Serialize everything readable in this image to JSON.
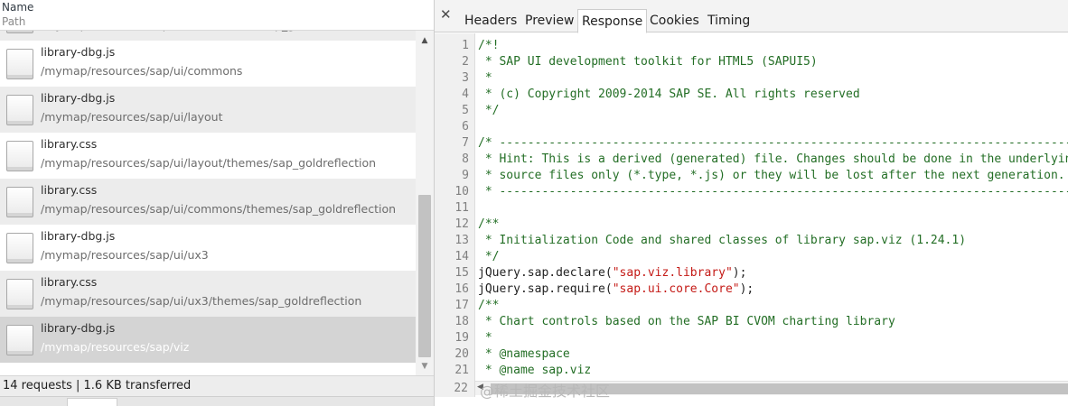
{
  "network": {
    "header": {
      "name": "Name",
      "path": "Path"
    },
    "requests": [
      {
        "name": "",
        "path": "/mymap/resources/sap/ui/core/themes/sap_goldreflection",
        "selected": false,
        "partial": true
      },
      {
        "name": "library-dbg.js",
        "path": "/mymap/resources/sap/ui/commons",
        "selected": false
      },
      {
        "name": "library-dbg.js",
        "path": "/mymap/resources/sap/ui/layout",
        "selected": false
      },
      {
        "name": "library.css",
        "path": "/mymap/resources/sap/ui/layout/themes/sap_goldreflection",
        "selected": false
      },
      {
        "name": "library.css",
        "path": "/mymap/resources/sap/ui/commons/themes/sap_goldreflection",
        "selected": false
      },
      {
        "name": "library-dbg.js",
        "path": "/mymap/resources/sap/ui/ux3",
        "selected": false
      },
      {
        "name": "library.css",
        "path": "/mymap/resources/sap/ui/ux3/themes/sap_goldreflection",
        "selected": false
      },
      {
        "name": "library-dbg.js",
        "path": "/mymap/resources/sap/viz",
        "selected": true
      }
    ],
    "status": "14 requests | 1.6 KB transferred",
    "scroll_up_icon": "▲",
    "scroll_down_icon": "▼"
  },
  "detail": {
    "close_icon": "✕",
    "tabs": [
      {
        "label": "Headers",
        "active": false
      },
      {
        "label": "Preview",
        "active": false
      },
      {
        "label": "Response",
        "active": true
      },
      {
        "label": "Cookies",
        "active": false
      },
      {
        "label": "Timing",
        "active": false
      }
    ],
    "code_lines": [
      {
        "n": "1",
        "parts": [
          {
            "t": "/*!",
            "c": "comment"
          }
        ]
      },
      {
        "n": "2",
        "parts": [
          {
            "t": " * SAP UI development toolkit for HTML5 (SAPUI5)",
            "c": "comment"
          }
        ]
      },
      {
        "n": "3",
        "parts": [
          {
            "t": " *",
            "c": "comment"
          }
        ]
      },
      {
        "n": "4",
        "parts": [
          {
            "t": " * (c) Copyright 2009-2014 SAP SE. All rights reserved",
            "c": "comment"
          }
        ]
      },
      {
        "n": "5",
        "parts": [
          {
            "t": " */",
            "c": "comment"
          }
        ]
      },
      {
        "n": "6",
        "parts": [
          {
            "t": "",
            "c": "plain"
          }
        ]
      },
      {
        "n": "7",
        "parts": [
          {
            "t": "/* -----------------------------------------------------------------------------------",
            "c": "comment"
          }
        ]
      },
      {
        "n": "8",
        "parts": [
          {
            "t": " * Hint: This is a derived (generated) file. Changes should be done in the underlying",
            "c": "comment"
          }
        ]
      },
      {
        "n": "9",
        "parts": [
          {
            "t": " * source files only (*.type, *.js) or they will be lost after the next generation.",
            "c": "comment"
          }
        ]
      },
      {
        "n": "10",
        "parts": [
          {
            "t": " * -----------------------------------------------------------------------------------",
            "c": "comment"
          }
        ]
      },
      {
        "n": "11",
        "parts": [
          {
            "t": "",
            "c": "plain"
          }
        ]
      },
      {
        "n": "12",
        "parts": [
          {
            "t": "/**",
            "c": "comment"
          }
        ]
      },
      {
        "n": "13",
        "parts": [
          {
            "t": " * Initialization Code and shared classes of library sap.viz (1.24.1)",
            "c": "comment"
          }
        ]
      },
      {
        "n": "14",
        "parts": [
          {
            "t": " */",
            "c": "comment"
          }
        ]
      },
      {
        "n": "15",
        "parts": [
          {
            "t": "jQuery.sap.declare(",
            "c": "plain"
          },
          {
            "t": "\"sap.viz.library\"",
            "c": "string"
          },
          {
            "t": ");",
            "c": "plain"
          }
        ]
      },
      {
        "n": "16",
        "parts": [
          {
            "t": "jQuery.sap.require(",
            "c": "plain"
          },
          {
            "t": "\"sap.ui.core.Core\"",
            "c": "string"
          },
          {
            "t": ");",
            "c": "plain"
          }
        ]
      },
      {
        "n": "17",
        "parts": [
          {
            "t": "/**",
            "c": "comment"
          }
        ]
      },
      {
        "n": "18",
        "parts": [
          {
            "t": " * Chart controls based on the SAP BI CVOM charting library",
            "c": "comment"
          }
        ]
      },
      {
        "n": "19",
        "parts": [
          {
            "t": " *",
            "c": "comment"
          }
        ]
      },
      {
        "n": "20",
        "parts": [
          {
            "t": " * @namespace",
            "c": "comment"
          }
        ]
      },
      {
        "n": "21",
        "parts": [
          {
            "t": " * @name sap.viz",
            "c": "comment"
          }
        ]
      }
    ],
    "last_line_number": "22",
    "hscroll_left_icon": "◀"
  },
  "watermark": "@稀土掘金技术社区",
  "colors": {
    "comment": "#236e25",
    "string": "#c41a16",
    "selected_row": "#d4d4d4",
    "alt_row": "#ececec"
  }
}
